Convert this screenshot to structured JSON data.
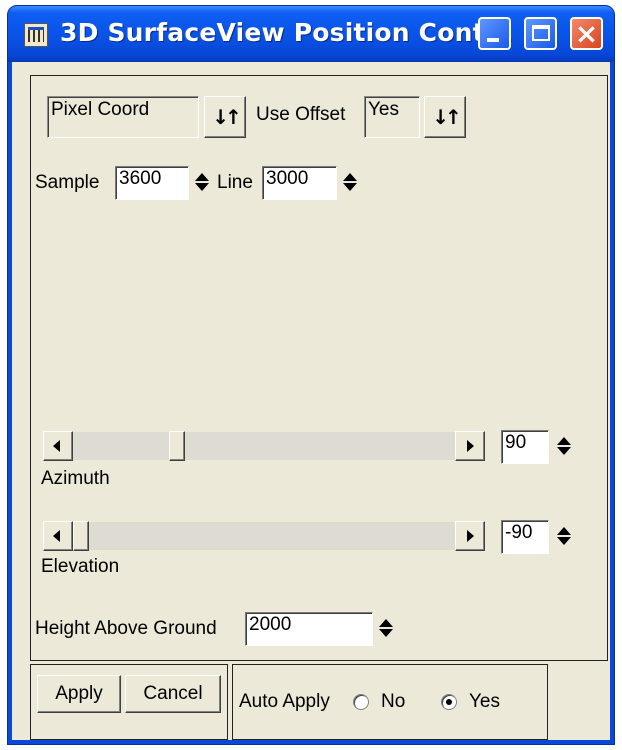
{
  "window": {
    "title": "3D SurfaceView Position Cont...",
    "controls": [
      "minimize",
      "maximize",
      "close"
    ]
  },
  "coord_mode": {
    "value": "Pixel Coord",
    "toggle_icon": "up-down-arrows-icon"
  },
  "offset": {
    "label": "Use Offset",
    "value": "Yes",
    "toggle_icon": "up-down-arrows-icon"
  },
  "sample": {
    "label": "Sample",
    "value": "3600"
  },
  "line": {
    "label": "Line",
    "value": "3000"
  },
  "azimuth": {
    "label": "Azimuth",
    "value": "90"
  },
  "elevation": {
    "label": "Elevation",
    "value": "-90"
  },
  "height": {
    "label": "Height Above Ground",
    "value": "2000"
  },
  "buttons": {
    "apply": "Apply",
    "cancel": "Cancel"
  },
  "auto_apply": {
    "label": "Auto Apply",
    "options": [
      "No",
      "Yes"
    ],
    "selected": "Yes"
  },
  "colors": {
    "title_bar": "#0a54e8",
    "window_bg": "#ece9d8",
    "close_button": "#d9431f"
  }
}
